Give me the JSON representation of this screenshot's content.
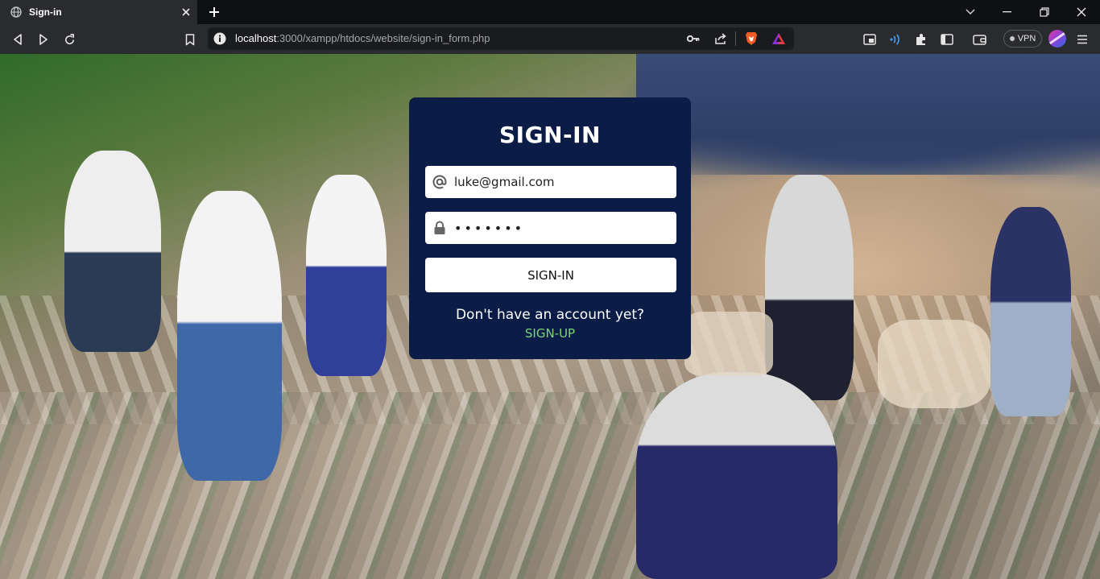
{
  "browser": {
    "tab": {
      "title": "Sign-in",
      "favicon": "globe-icon",
      "close_icon": "close-icon"
    },
    "new_tab_icon": "plus-icon",
    "window_controls": [
      "chevron-down-icon",
      "minimize-icon",
      "restore-icon",
      "close-icon"
    ],
    "nav": [
      "back-icon",
      "forward-icon",
      "reload-icon",
      "bookmark-icon"
    ],
    "address": {
      "security_icon": "info-icon",
      "host": "localhost",
      "path": ":3000/xampp/htdocs/website/sign-in_form.php"
    },
    "address_actions": [
      "key-icon",
      "share-icon",
      "brave-shield-icon",
      "brave-rewards-icon"
    ],
    "extensions": [
      "media-icon",
      "wallet-audio-icon",
      "puzzle-icon",
      "sidebar-icon",
      "wallet-icon"
    ],
    "vpn_label": "VPN",
    "menu_icon": "hamburger-icon",
    "colors": {
      "tabstrip": "#0f1013",
      "toolbar": "#2a2b2f",
      "urlbar": "#1a1b1e"
    }
  },
  "page": {
    "background": "photo of volunteers collecting plastic trash on a beach",
    "card": {
      "title": "SIGN-IN",
      "email": {
        "icon": "at-icon",
        "value": "luke@gmail.com"
      },
      "password": {
        "icon": "lock-icon",
        "value": "•••••••"
      },
      "submit_label": "SIGN-IN",
      "prompt": "Don't have an account yet?",
      "signup_label": "SIGN-UP",
      "colors": {
        "card": "#0b1d47",
        "signup": "#7bd67a"
      }
    }
  }
}
